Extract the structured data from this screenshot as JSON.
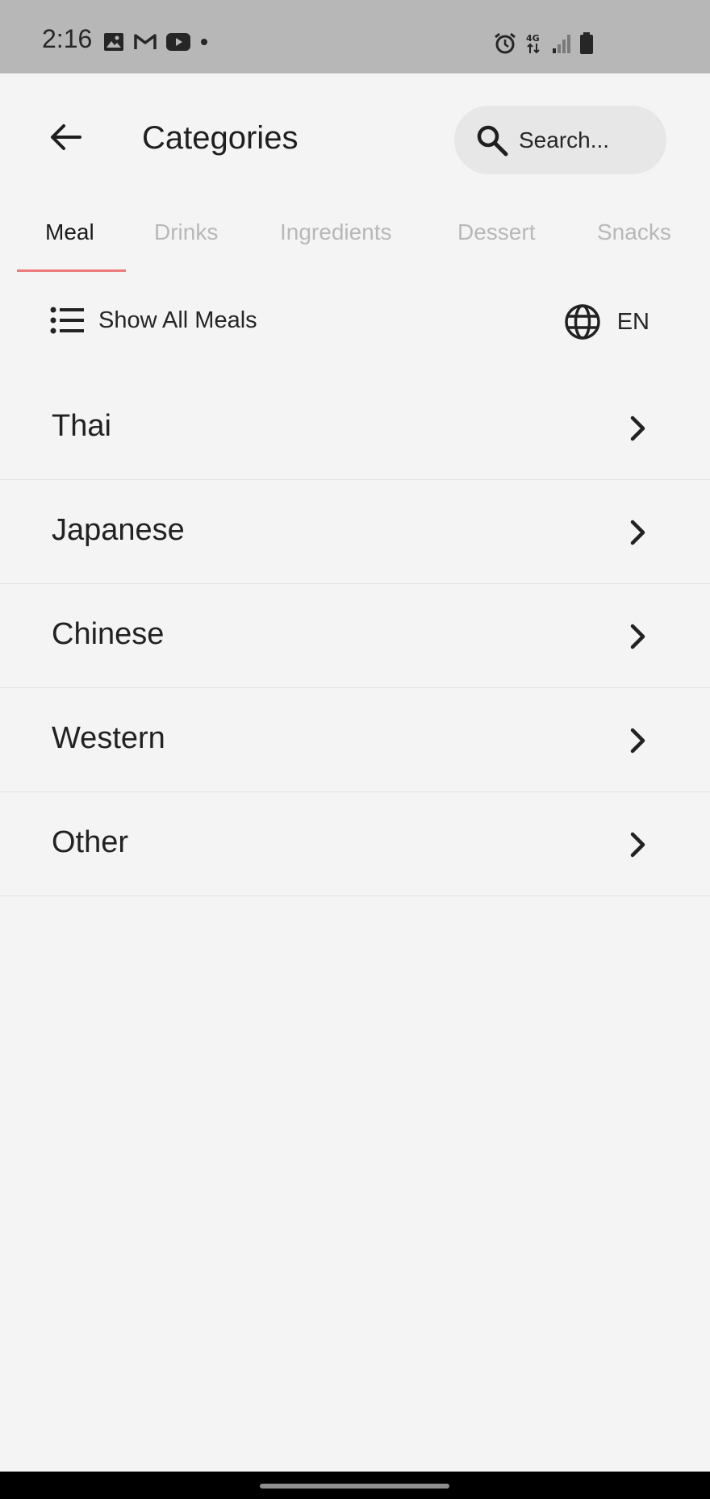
{
  "status_bar": {
    "time": "2:16"
  },
  "header": {
    "title": "Categories",
    "search_placeholder": "Search..."
  },
  "tabs": [
    {
      "label": "Meal",
      "active": true
    },
    {
      "label": "Drinks",
      "active": false
    },
    {
      "label": "Ingredients",
      "active": false
    },
    {
      "label": "Dessert",
      "active": false
    },
    {
      "label": "Snacks",
      "active": false
    }
  ],
  "toolbar": {
    "show_all_label": "Show All Meals",
    "language": "EN"
  },
  "categories": [
    "Thai",
    "Japanese",
    "Chinese",
    "Western",
    "Other"
  ],
  "colors": {
    "tab_indicator": "#ec7b7b",
    "background": "#f4f4f4",
    "status_bar": "#b7b7b7"
  }
}
